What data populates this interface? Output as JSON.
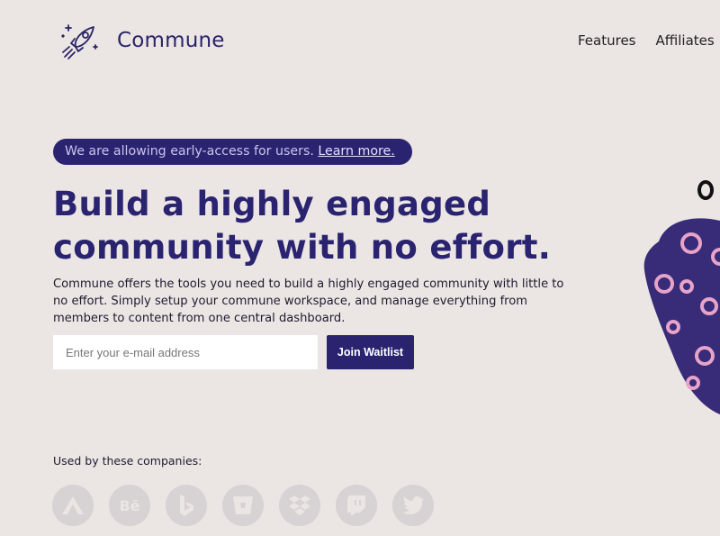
{
  "header": {
    "brand": "Commune",
    "nav": [
      {
        "label": "Features"
      },
      {
        "label": "Affiliates"
      }
    ]
  },
  "hero": {
    "banner_text": "We are allowing early-access for users.",
    "banner_link": "Learn more.",
    "headline_line1": "Build a highly engaged",
    "headline_line2": "community with no effort.",
    "description": "Commune offers the tools you need to build a highly engaged community with little to no effort. Simply setup your commune workspace, and manage everything from members to content from one central dashboard.",
    "email_placeholder": "Enter your e-mail address",
    "email_value": "",
    "join_label": "Join Waitlist"
  },
  "companies": {
    "label": "Used by these companies:",
    "logos": [
      {
        "icon": "aerolab-icon"
      },
      {
        "icon": "behance-icon",
        "text": "Bē"
      },
      {
        "icon": "bing-icon"
      },
      {
        "icon": "bitbucket-icon"
      },
      {
        "icon": "dropbox-icon"
      },
      {
        "icon": "twitch-icon"
      },
      {
        "icon": "twitter-icon"
      }
    ]
  },
  "colors": {
    "background": "#ebe5e4",
    "brand": "#2a2370",
    "logo_circle": "#d7d2d3",
    "blob_dots": "#e7a3c9"
  }
}
